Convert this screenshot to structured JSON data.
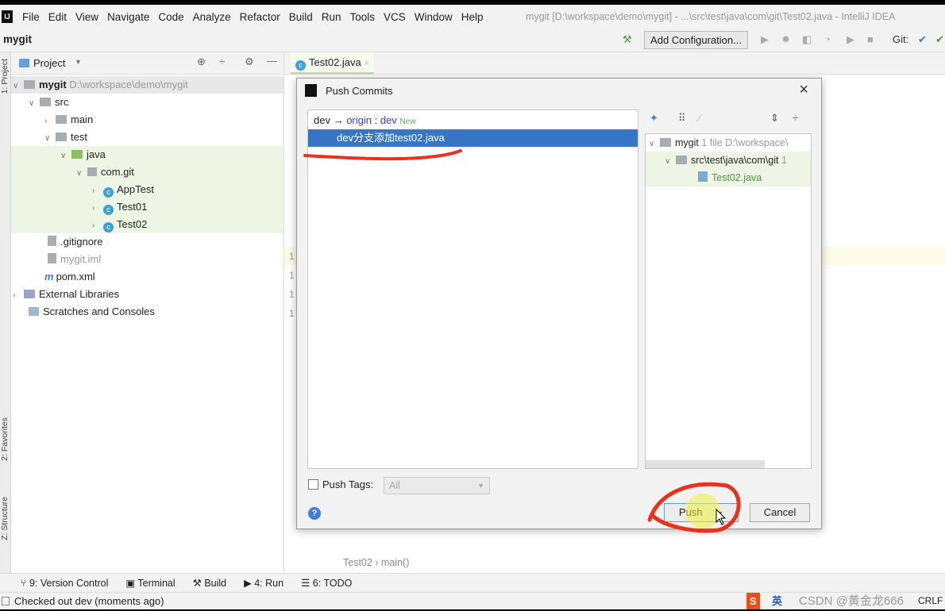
{
  "menu": {
    "items": [
      "File",
      "Edit",
      "View",
      "Navigate",
      "Code",
      "Analyze",
      "Refactor",
      "Build",
      "Run",
      "Tools",
      "VCS",
      "Window",
      "Help"
    ],
    "window_title": "mygit [D:\\workspace\\demo\\mygit] - ...\\src\\test\\java\\com\\git\\Test02.java - IntelliJ IDEA"
  },
  "toolbar": {
    "project": "mygit",
    "add_config": "Add Configuration...",
    "git_label": "Git:"
  },
  "side_labels": {
    "project": "1: Project",
    "favorites": "2: Favorites",
    "structure": "Z: Structure"
  },
  "project_panel": {
    "title": "Project",
    "tree": [
      {
        "label": "mygit",
        "extra": "D:\\workspace\\demo\\mygit"
      },
      {
        "label": "src"
      },
      {
        "label": "main"
      },
      {
        "label": "test"
      },
      {
        "label": "java"
      },
      {
        "label": "com.git"
      },
      {
        "label": "AppTest"
      },
      {
        "label": "Test01"
      },
      {
        "label": "Test02"
      },
      {
        "label": ".gitignore"
      },
      {
        "label": "mygit.iml"
      },
      {
        "label": "pom.xml"
      },
      {
        "label": "External Libraries"
      },
      {
        "label": "Scratches and Consoles"
      }
    ]
  },
  "editor": {
    "tab": "Test02.java",
    "gutter": [
      "1",
      "1",
      "1",
      "1"
    ],
    "breadcrumb": [
      "Test02",
      "main()"
    ]
  },
  "dialog": {
    "title": "Push Commits",
    "branch_local": "dev",
    "branch_remote": "origin",
    "branch_target": "dev",
    "branch_badge": "New",
    "commit": "dev分支添加test02.java",
    "files": {
      "root": "mygit",
      "root_count": "1 file",
      "root_path": "D:\\workspace\\",
      "dir": "src\\test\\java\\com\\git",
      "dir_count": "1",
      "file": "Test02.java"
    },
    "push_tags_label": "Push Tags:",
    "push_tags_value": "All",
    "push": "Push",
    "cancel": "Cancel",
    "help": "?"
  },
  "bottom_tools": [
    "9: Version Control",
    "Terminal",
    "Build",
    "4: Run",
    "6: TODO"
  ],
  "status": {
    "message": "Checked out dev (moments ago)",
    "watermark": "CSDN @黄金龙666",
    "line_sep": "CRLF",
    "ime": "英"
  },
  "colors": {
    "selection": "#3676c5",
    "annotation": "#e8321e",
    "highlight": "#f0f040"
  }
}
